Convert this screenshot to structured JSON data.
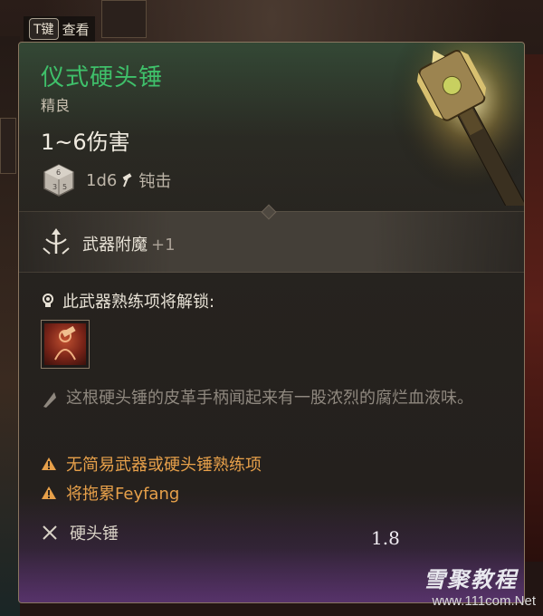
{
  "key_hint": {
    "key": "T键",
    "action": "查看"
  },
  "item": {
    "name": "仪式硬头锤",
    "rarity": "精良",
    "damage": "1~6伤害",
    "dice": "1d6",
    "damage_type": "钝击",
    "enchant_label": "武器附魔",
    "enchant_value": "+1",
    "unlock_text": "此武器熟练项将解锁:",
    "description": "这根硬头锤的皮革手柄闻起来有一股浓烈的腐烂血液味。",
    "warnings": [
      "无简易武器或硬头锤熟练项",
      "将拖累Feyfang"
    ],
    "weapon_type": "硬头锤",
    "weight": "1.8"
  },
  "watermark": {
    "brand": "雪聚教程",
    "site": "www.111com.Net"
  },
  "colors": {
    "name_green": "#3fc06a",
    "warning_orange": "#e7a04a",
    "panel_border": "#8a7660"
  },
  "icons": [
    "dice-icon",
    "hammer-icon",
    "enchant-icon",
    "bulb-icon",
    "mastery-icon",
    "quill-icon",
    "warning-icon",
    "crossed-swords-icon",
    "weapon-art"
  ]
}
